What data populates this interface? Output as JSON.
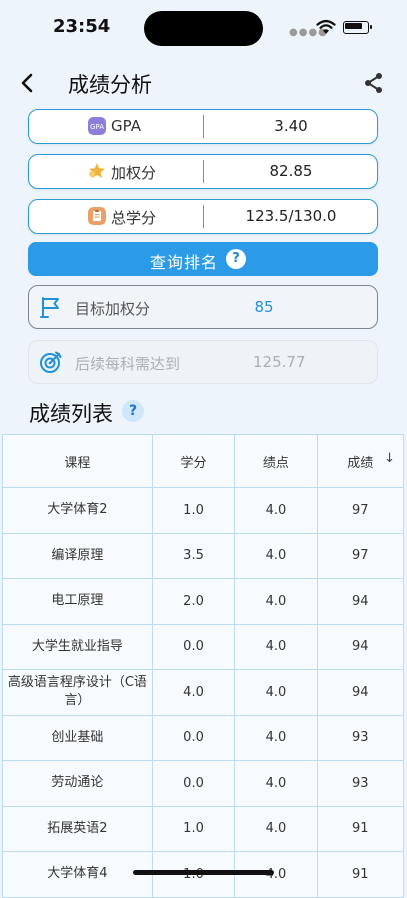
{
  "status_bar": {
    "time": "23:54"
  },
  "header": {
    "title": "成绩分析"
  },
  "summary": [
    {
      "icon": "gpa-icon",
      "label": "GPA",
      "value": "3.40",
      "color": "#8b7fd8"
    },
    {
      "icon": "star-icon",
      "label": "加权分",
      "value": "82.85",
      "color": "#f0b23a"
    },
    {
      "icon": "clipboard-icon",
      "label": "总学分",
      "value": "123.5/130.0",
      "color": "#e9a169"
    }
  ],
  "rank_button": {
    "label": "查询排名",
    "help": "?"
  },
  "target": {
    "label": "目标加权分",
    "value": "85"
  },
  "required": {
    "label": "后续每科需达到",
    "value": "125.77"
  },
  "grades": {
    "title": "成绩列表",
    "help": "?",
    "columns": [
      "课程",
      "学分",
      "绩点",
      "成绩"
    ],
    "rows": [
      {
        "course": "大学体育2",
        "credit": "1.0",
        "point": "4.0",
        "score": "97"
      },
      {
        "course": "编译原理",
        "credit": "3.5",
        "point": "4.0",
        "score": "97"
      },
      {
        "course": "电工原理",
        "credit": "2.0",
        "point": "4.0",
        "score": "94"
      },
      {
        "course": "大学生就业指导",
        "credit": "0.0",
        "point": "4.0",
        "score": "94"
      },
      {
        "course": "高级语言程序设计（C语言）",
        "credit": "4.0",
        "point": "4.0",
        "score": "94"
      },
      {
        "course": "创业基础",
        "credit": "0.0",
        "point": "4.0",
        "score": "93"
      },
      {
        "course": "劳动通论",
        "credit": "0.0",
        "point": "4.0",
        "score": "93"
      },
      {
        "course": "拓展英语2",
        "credit": "1.0",
        "point": "4.0",
        "score": "91"
      },
      {
        "course": "大学体育4",
        "credit": "1.0",
        "point": "4.0",
        "score": "91"
      }
    ]
  },
  "colors": {
    "accent": "#2b9be8",
    "border": "#2a9ad6",
    "background": "#edf4fb"
  }
}
